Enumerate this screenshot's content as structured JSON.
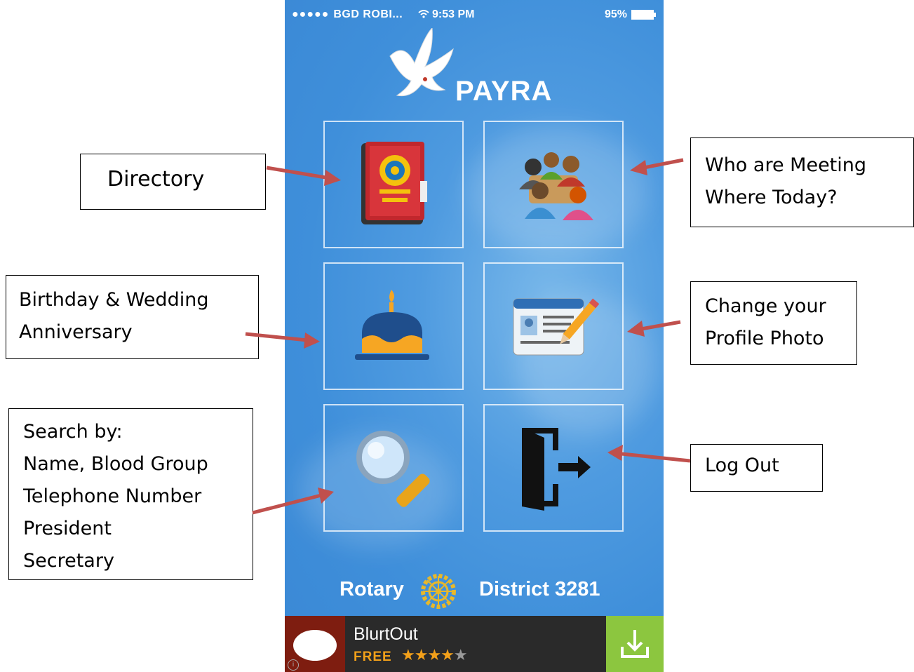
{
  "status_bar": {
    "signal_dots": "●●●●●",
    "carrier": "BGD ROBI...",
    "wifi_icon": "wifi-icon",
    "time": "9:53 PM",
    "battery": "95%"
  },
  "app": {
    "name": "PAYRA",
    "logo_icon": "dove-icon"
  },
  "tiles": [
    {
      "name": "directory",
      "icon": "book-icon"
    },
    {
      "name": "meeting",
      "icon": "people-meeting-icon"
    },
    {
      "name": "birthday",
      "icon": "cake-icon"
    },
    {
      "name": "profile",
      "icon": "id-card-pencil-icon"
    },
    {
      "name": "search",
      "icon": "magnifier-icon"
    },
    {
      "name": "logout",
      "icon": "door-exit-icon"
    }
  ],
  "footer": {
    "left": "Rotary",
    "right": "District 3281",
    "icon": "rotary-wheel-icon"
  },
  "ad": {
    "title": "BlurtOut",
    "free": "FREE",
    "stars": "★★★★",
    "star_off": "★",
    "download_icon": "download-icon",
    "info_icon": "info-icon"
  },
  "callouts": {
    "directory": "Directory",
    "meeting": "Who are Meeting\nWhere Today?",
    "birthday": "Birthday & Wedding\nAnniversary",
    "profile": "Change your\nProfile Photo",
    "search": "Search by:\nName, Blood Group\nTelephone Number\nPresident\nSecretary",
    "logout": "Log Out"
  },
  "colors": {
    "sky": "#3f8fda",
    "arrow": "#c0504d",
    "ad_green": "#8cc63f",
    "ad_red": "#7e1d10",
    "star": "#f2a01a"
  }
}
